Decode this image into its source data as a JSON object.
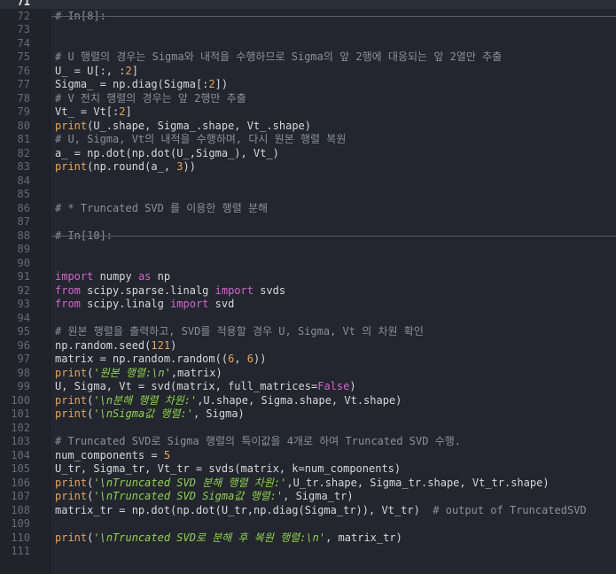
{
  "editor": {
    "active_line": "71",
    "lines": [
      {
        "n": "71",
        "t": [
          [
            "p",
            "    "
          ]
        ]
      },
      {
        "n": "72",
        "t": [
          [
            "c",
            "# In[8]:"
          ]
        ]
      },
      {
        "n": "73",
        "t": []
      },
      {
        "n": "74",
        "t": []
      },
      {
        "n": "75",
        "t": [
          [
            "c",
            "# U 행렬의 경우는 Sigma와 내적을 수행하므로 Sigma의 앞 2행에 대응되는 앞 2열만 추출"
          ]
        ]
      },
      {
        "n": "76",
        "t": [
          [
            "p",
            "U_ = U[:, :"
          ],
          [
            "n",
            "2"
          ],
          [
            "p",
            "]"
          ]
        ]
      },
      {
        "n": "77",
        "t": [
          [
            "p",
            "Sigma_ = np.diag(Sigma[:"
          ],
          [
            "n",
            "2"
          ],
          [
            "p",
            "])"
          ]
        ]
      },
      {
        "n": "78",
        "t": [
          [
            "c",
            "# V 전치 행렬의 경우는 앞 2행만 추출"
          ]
        ]
      },
      {
        "n": "79",
        "t": [
          [
            "p",
            "Vt_ = Vt[:"
          ],
          [
            "n",
            "2"
          ],
          [
            "p",
            "]"
          ]
        ]
      },
      {
        "n": "80",
        "t": [
          [
            "f",
            "print"
          ],
          [
            "p",
            "(U_.shape, Sigma_.shape, Vt_.shape)"
          ]
        ]
      },
      {
        "n": "81",
        "t": [
          [
            "c",
            "# U, Sigma, Vt의 내적을 수행하며, 다시 원본 행렬 복원"
          ]
        ]
      },
      {
        "n": "82",
        "t": [
          [
            "p",
            "a_ = np.dot(np.dot(U_,Sigma_), Vt_)"
          ]
        ]
      },
      {
        "n": "83",
        "t": [
          [
            "f",
            "print"
          ],
          [
            "p",
            "(np.round(a_, "
          ],
          [
            "n",
            "3"
          ],
          [
            "p",
            "))"
          ]
        ]
      },
      {
        "n": "84",
        "t": []
      },
      {
        "n": "85",
        "t": []
      },
      {
        "n": "86",
        "t": [
          [
            "c",
            "# * Truncated SVD 를 이용한 행렬 분해"
          ]
        ]
      },
      {
        "n": "87",
        "t": []
      },
      {
        "n": "88",
        "t": [
          [
            "c",
            "# In[10]:"
          ]
        ]
      },
      {
        "n": "89",
        "t": []
      },
      {
        "n": "90",
        "t": []
      },
      {
        "n": "91",
        "t": [
          [
            "k",
            "import"
          ],
          [
            "p",
            " numpy "
          ],
          [
            "k",
            "as"
          ],
          [
            "p",
            " np"
          ]
        ]
      },
      {
        "n": "92",
        "t": [
          [
            "k",
            "from"
          ],
          [
            "p",
            " scipy.sparse.linalg "
          ],
          [
            "k",
            "import"
          ],
          [
            "p",
            " svds"
          ]
        ]
      },
      {
        "n": "93",
        "t": [
          [
            "k",
            "from"
          ],
          [
            "p",
            " scipy.linalg "
          ],
          [
            "k",
            "import"
          ],
          [
            "p",
            " svd"
          ]
        ]
      },
      {
        "n": "94",
        "t": []
      },
      {
        "n": "95",
        "t": [
          [
            "c",
            "# 원본 행렬을 출력하고, SVD를 적용할 경우 U, Sigma, Vt 의 차원 확인"
          ]
        ]
      },
      {
        "n": "96",
        "t": [
          [
            "p",
            "np.random.seed("
          ],
          [
            "n",
            "121"
          ],
          [
            "p",
            ")"
          ]
        ]
      },
      {
        "n": "97",
        "t": [
          [
            "p",
            "matrix = np.random.random(("
          ],
          [
            "n",
            "6"
          ],
          [
            "p",
            ", "
          ],
          [
            "n",
            "6"
          ],
          [
            "p",
            "))"
          ]
        ]
      },
      {
        "n": "98",
        "t": [
          [
            "f",
            "print"
          ],
          [
            "p",
            "("
          ],
          [
            "s",
            "'"
          ],
          [
            "e",
            "원본 행렬:\\n"
          ],
          [
            "s",
            "'"
          ],
          [
            "p",
            ",matrix)"
          ]
        ]
      },
      {
        "n": "99",
        "t": [
          [
            "p",
            "U, Sigma, Vt = svd(matrix, full_matrices="
          ],
          [
            "k",
            "False"
          ],
          [
            "p",
            ")"
          ]
        ]
      },
      {
        "n": "100",
        "t": [
          [
            "f",
            "print"
          ],
          [
            "p",
            "("
          ],
          [
            "s",
            "'"
          ],
          [
            "e",
            "\\n분해 행렬 차원:"
          ],
          [
            "s",
            "'"
          ],
          [
            "p",
            ",U.shape, Sigma.shape, Vt.shape)"
          ]
        ]
      },
      {
        "n": "101",
        "t": [
          [
            "f",
            "print"
          ],
          [
            "p",
            "("
          ],
          [
            "s",
            "'"
          ],
          [
            "e",
            "\\nSigma값 행렬:"
          ],
          [
            "s",
            "'"
          ],
          [
            "p",
            ", Sigma)"
          ]
        ]
      },
      {
        "n": "102",
        "t": []
      },
      {
        "n": "103",
        "t": [
          [
            "c",
            "# Truncated SVD로 Sigma 행렬의 특이값을 4개로 하여 Truncated SVD 수행."
          ]
        ]
      },
      {
        "n": "104",
        "t": [
          [
            "p",
            "num_components = "
          ],
          [
            "n",
            "5"
          ]
        ]
      },
      {
        "n": "105",
        "t": [
          [
            "p",
            "U_tr, Sigma_tr, Vt_tr = svds(matrix, k=num_components)"
          ]
        ]
      },
      {
        "n": "106",
        "t": [
          [
            "f",
            "print"
          ],
          [
            "p",
            "("
          ],
          [
            "s",
            "'"
          ],
          [
            "e",
            "\\nTruncated SVD 분해 행렬 차원:"
          ],
          [
            "s",
            "'"
          ],
          [
            "p",
            ",U_tr.shape, Sigma_tr.shape, Vt_tr.shape)"
          ]
        ]
      },
      {
        "n": "107",
        "t": [
          [
            "f",
            "print"
          ],
          [
            "p",
            "("
          ],
          [
            "s",
            "'"
          ],
          [
            "e",
            "\\nTruncated SVD Sigma값 행렬:"
          ],
          [
            "s",
            "'"
          ],
          [
            "p",
            ", Sigma_tr)"
          ]
        ]
      },
      {
        "n": "108",
        "t": [
          [
            "p",
            "matrix_tr = np.dot(np.dot(U_tr,np.diag(Sigma_tr)), Vt_tr)  "
          ],
          [
            "c",
            "# output of TruncatedSVD"
          ]
        ]
      },
      {
        "n": "109",
        "t": []
      },
      {
        "n": "110",
        "t": [
          [
            "f",
            "print"
          ],
          [
            "p",
            "("
          ],
          [
            "s",
            "'"
          ],
          [
            "e",
            "\\nTruncated SVD로 분해 후 복원 행렬:\\n"
          ],
          [
            "s",
            "'"
          ],
          [
            "p",
            ", matrix_tr)"
          ]
        ]
      },
      {
        "n": "111",
        "t": []
      }
    ]
  }
}
